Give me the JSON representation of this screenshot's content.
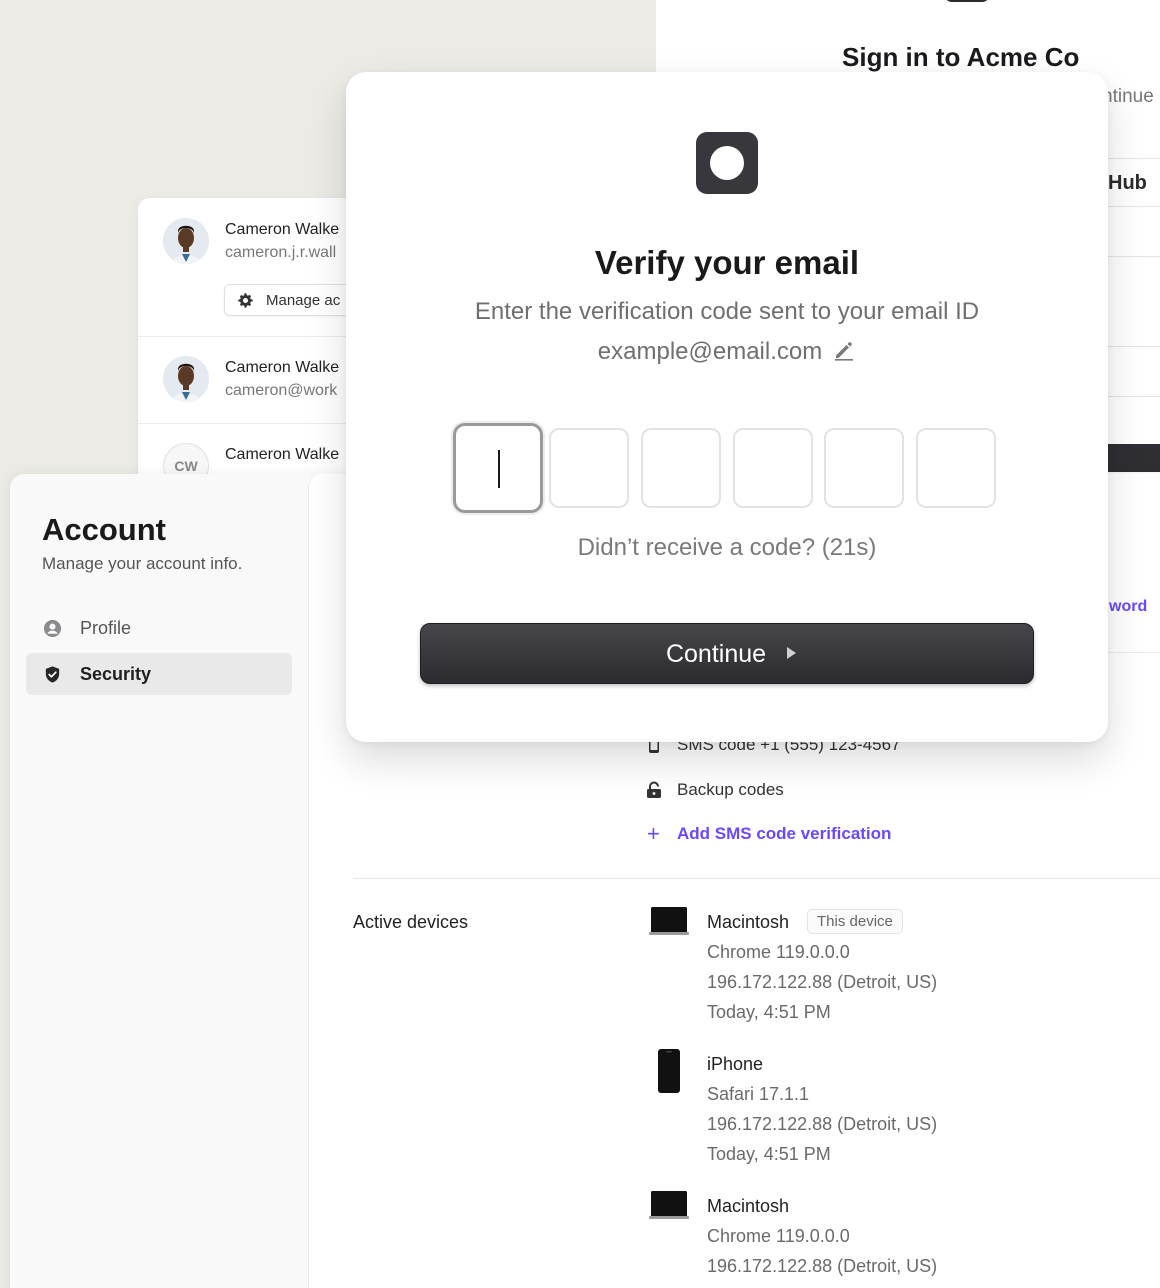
{
  "signin": {
    "title": "Sign in to Acme Co",
    "subtitle_fragment": "ntinue",
    "provider_fragment": "Hub",
    "forgot_fragment": "word"
  },
  "switcher": {
    "accounts": [
      {
        "name": "Cameron Walke",
        "email": "cameron.j.r.wall"
      },
      {
        "name": "Cameron Walke",
        "email": "cameron@work"
      },
      {
        "name": "Cameron Walke",
        "initials": "CW"
      }
    ],
    "manage_label": "Manage ac"
  },
  "account": {
    "title": "Account",
    "subtitle": "Manage your account info.",
    "nav": [
      {
        "label": "Profile",
        "icon": "user-circle-icon"
      },
      {
        "label": "Security",
        "icon": "shield-check-icon",
        "active": true
      }
    ]
  },
  "mfa": {
    "sms_partial": "SMS code +1 (555) 123-4567",
    "backup_codes": "Backup codes",
    "add_sms": "Add SMS code verification"
  },
  "devices": {
    "title": "Active devices",
    "items": [
      {
        "name": "Macintosh",
        "badge": "This device",
        "browser": "Chrome 119.0.0.0",
        "ip": "196.172.122.88 (Detroit, US)",
        "time": "Today, 4:51 PM",
        "icon": "laptop-icon"
      },
      {
        "name": "iPhone",
        "browser": "Safari 17.1.1",
        "ip": "196.172.122.88 (Detroit, US)",
        "time": "Today, 4:51 PM",
        "icon": "phone-icon"
      },
      {
        "name": "Macintosh",
        "browser": "Chrome 119.0.0.0",
        "ip": "196.172.122.88 (Detroit, US)",
        "icon": "laptop-icon"
      }
    ]
  },
  "modal": {
    "title": "Verify your email",
    "subtitle": "Enter the verification code sent to your email ID",
    "email": "example@email.com",
    "otp_length": 6,
    "resend": "Didn’t receive a code? (21s)",
    "continue_label": "Continue"
  },
  "colors": {
    "accent": "#6c47ff",
    "primary_button": "#2f2f33",
    "background": "#ecebe6"
  }
}
